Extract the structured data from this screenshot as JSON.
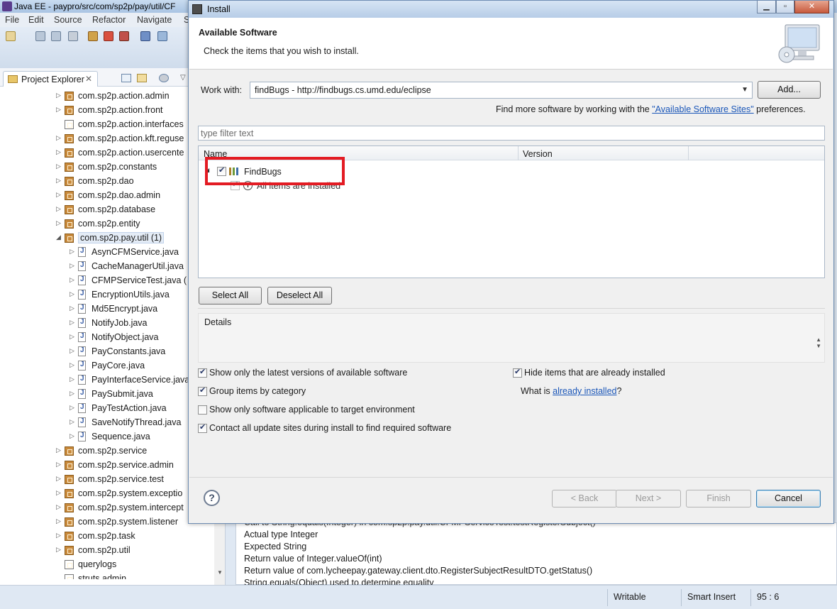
{
  "eclipse": {
    "title": "Java EE - paypro/src/com/sp2p/pay/util/CF",
    "menu": [
      "File",
      "Edit",
      "Source",
      "Refactor",
      "Navigate",
      "S"
    ],
    "explorer_tab": "Project Explorer",
    "tree": [
      {
        "type": "package",
        "label": "com.sp2p.action.admin",
        "arrow": "▷"
      },
      {
        "type": "package",
        "label": "com.sp2p.action.front",
        "arrow": "▷"
      },
      {
        "type": "package-empty",
        "label": "com.sp2p.action.interfaces",
        "arrow": ""
      },
      {
        "type": "package",
        "label": "com.sp2p.action.kft.reguse",
        "arrow": "▷"
      },
      {
        "type": "package",
        "label": "com.sp2p.action.usercente",
        "arrow": "▷"
      },
      {
        "type": "package",
        "label": "com.sp2p.constants",
        "arrow": "▷"
      },
      {
        "type": "package",
        "label": "com.sp2p.dao",
        "arrow": "▷"
      },
      {
        "type": "package",
        "label": "com.sp2p.dao.admin",
        "arrow": "▷"
      },
      {
        "type": "package",
        "label": "com.sp2p.database",
        "arrow": "▷"
      },
      {
        "type": "package",
        "label": "com.sp2p.entity",
        "arrow": "▷"
      },
      {
        "type": "package-open",
        "label": "com.sp2p.pay.util (1)",
        "arrow": "◢"
      },
      {
        "type": "java",
        "label": "AsynCFMService.java",
        "arrow": "▷"
      },
      {
        "type": "java",
        "label": "CacheManagerUtil.java",
        "arrow": "▷"
      },
      {
        "type": "java",
        "label": "CFMPServiceTest.java (",
        "arrow": "▷"
      },
      {
        "type": "java",
        "label": "EncryptionUtils.java",
        "arrow": "▷"
      },
      {
        "type": "java",
        "label": "Md5Encrypt.java",
        "arrow": "▷"
      },
      {
        "type": "java",
        "label": "NotifyJob.java",
        "arrow": "▷"
      },
      {
        "type": "java",
        "label": "NotifyObject.java",
        "arrow": "▷"
      },
      {
        "type": "java",
        "label": "PayConstants.java",
        "arrow": "▷"
      },
      {
        "type": "java",
        "label": "PayCore.java",
        "arrow": "▷"
      },
      {
        "type": "java",
        "label": "PayInterfaceService.java",
        "arrow": "▷"
      },
      {
        "type": "java",
        "label": "PaySubmit.java",
        "arrow": "▷"
      },
      {
        "type": "java",
        "label": "PayTestAction.java",
        "arrow": "▷"
      },
      {
        "type": "java",
        "label": "SaveNotifyThread.java",
        "arrow": "▷"
      },
      {
        "type": "java",
        "label": "Sequence.java",
        "arrow": "▷"
      },
      {
        "type": "package",
        "label": "com.sp2p.service",
        "arrow": "▷"
      },
      {
        "type": "package",
        "label": "com.sp2p.service.admin",
        "arrow": "▷"
      },
      {
        "type": "package",
        "label": "com.sp2p.service.test",
        "arrow": "▷"
      },
      {
        "type": "package",
        "label": "com.sp2p.system.exceptio",
        "arrow": "▷"
      },
      {
        "type": "package",
        "label": "com.sp2p.system.intercept",
        "arrow": "▷"
      },
      {
        "type": "package",
        "label": "com.sp2p.system.listener",
        "arrow": "▷"
      },
      {
        "type": "package",
        "label": "com.sp2p.task",
        "arrow": "▷"
      },
      {
        "type": "package",
        "label": "com.sp2p.util",
        "arrow": "▷"
      },
      {
        "type": "package-empty",
        "label": "querylogs",
        "arrow": ""
      },
      {
        "type": "package-empty",
        "label": "struts.admin",
        "arrow": ""
      }
    ],
    "bottom_lines": [
      "Call to String.equals(Integer) in com.sp2p.pay.util.CFMPServiceTest.testRegisterSubject()",
      "Actual type Integer",
      "Expected String",
      "Return value of Integer.valueOf(int)",
      "Return value of com.lycheepay.gateway.client.dto.RegisterSubjectResultDTO.getStatus()",
      "String.equals(Object) used to determine equality"
    ],
    "status": {
      "writable": "Writable",
      "insert": "Smart Insert",
      "position": "95 : 6"
    }
  },
  "dialog": {
    "title": "Install",
    "header_title": "Available Software",
    "header_desc": "Check the items that you wish to install.",
    "work_with_label": "Work with:",
    "work_with_value": "findBugs - http://findbugs.cs.umd.edu/eclipse",
    "add_button": "Add...",
    "find_more_prefix": "Find more software by working with the ",
    "find_more_link": "\"Available Software Sites\"",
    "find_more_suffix": " preferences.",
    "filter_placeholder": "type filter text",
    "columns": {
      "name": "Name",
      "version": "Version"
    },
    "items": [
      {
        "label": "FindBugs",
        "checked": true
      },
      {
        "label": "All items are installed",
        "checked": true
      }
    ],
    "select_all": "Select All",
    "deselect_all": "Deselect All",
    "details_label": "Details",
    "options": {
      "latest_versions": {
        "label": "Show only the latest versions of available software",
        "checked": true
      },
      "hide_installed": {
        "label": "Hide items that are already installed",
        "checked": true
      },
      "group_by_category": {
        "label": "Group items by category",
        "checked": true
      },
      "target_env": {
        "label": "Show only software applicable to target environment",
        "checked": false
      },
      "contact_sites": {
        "label": "Contact all update sites during install to find required software",
        "checked": true
      }
    },
    "what_is_prefix": "What is ",
    "what_is_link": "already installed",
    "what_is_suffix": "?",
    "buttons": {
      "back": "< Back",
      "next": "Next >",
      "finish": "Finish",
      "cancel": "Cancel"
    },
    "help": "?"
  }
}
